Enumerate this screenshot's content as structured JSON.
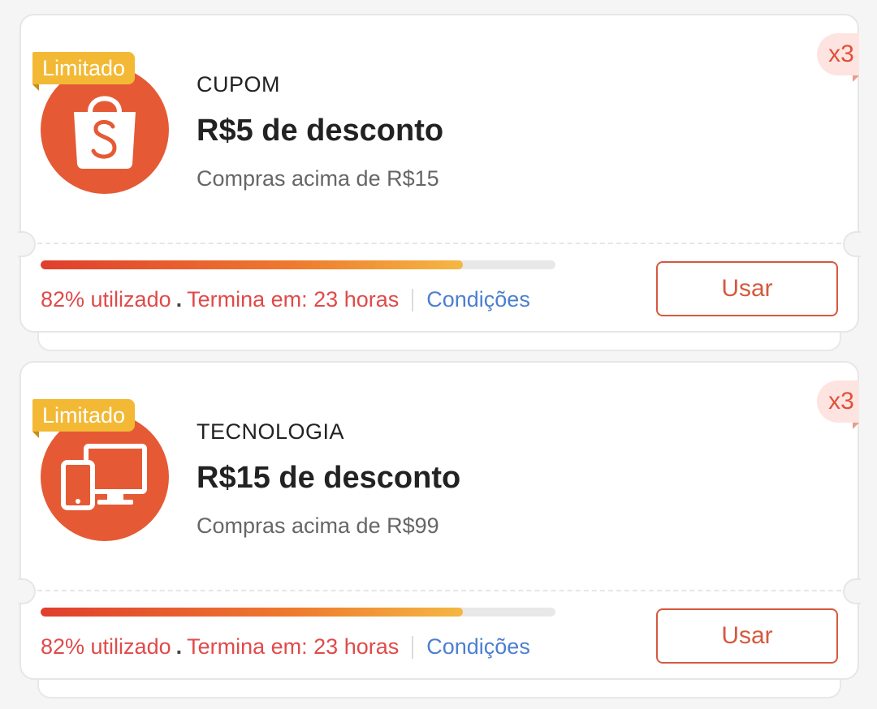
{
  "coupons": [
    {
      "tag": "Limitado",
      "quantity": "x3",
      "icon": "shopee-bag-icon",
      "category": "CUPOM",
      "title": "R$5 de desconto",
      "subtitle": "Compras acima de R$15",
      "progress_fraction": 0.82,
      "used_text": "82% utilizado",
      "dot": ".",
      "ends_text": "Termina em: 23 horas",
      "conditions": "Condições",
      "button": "Usar"
    },
    {
      "tag": "Limitado",
      "quantity": "x3",
      "icon": "devices-icon",
      "category": "TECNOLOGIA",
      "title": "R$15 de desconto",
      "subtitle": "Compras acima de R$99",
      "progress_fraction": 0.82,
      "used_text": "82% utilizado",
      "dot": ".",
      "ends_text": "Termina em: 23 horas",
      "conditions": "Condições",
      "button": "Usar"
    }
  ],
  "colors": {
    "brand": "#e55a35",
    "tag": "#f3b935",
    "used_text": "#e04a4a",
    "link": "#4c7fcf"
  }
}
